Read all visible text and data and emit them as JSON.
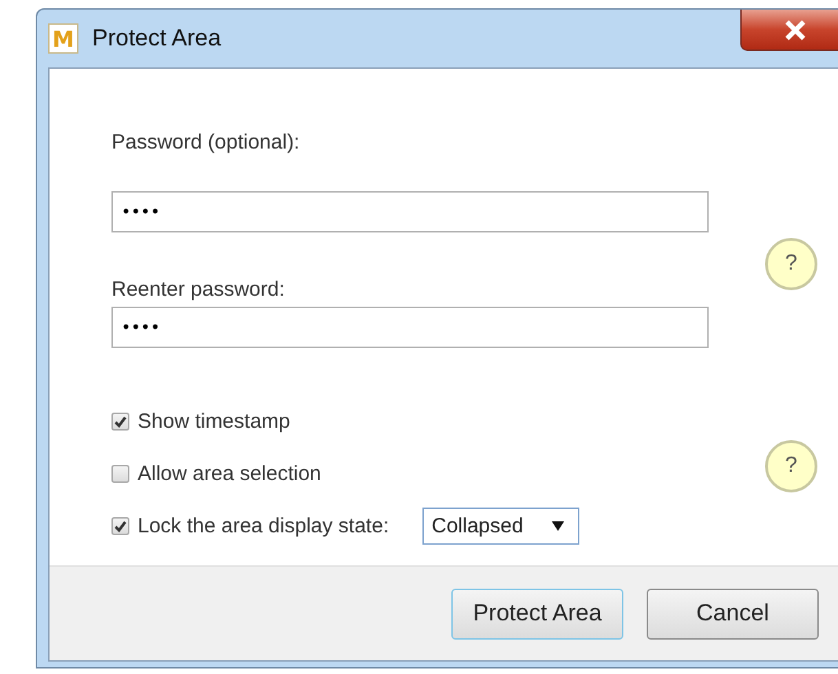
{
  "window": {
    "title": "Protect Area",
    "app_icon_letter": "M"
  },
  "password": {
    "label": "Password (optional):",
    "value": "••••"
  },
  "reenter": {
    "label": "Reenter password:",
    "value": "••••"
  },
  "help_buttons": [
    "?",
    "?"
  ],
  "options": [
    {
      "kind": "checkbox",
      "label": "Show timestamp",
      "checked": true
    },
    {
      "kind": "checkbox",
      "label": "Allow area selection",
      "checked": false
    },
    {
      "kind": "checkbox-select",
      "label": "Lock the area display state:",
      "checked": true,
      "select_value": "Collapsed"
    }
  ],
  "buttons": [
    {
      "label": "Protect Area",
      "default": true
    },
    {
      "label": "Cancel",
      "default": false
    }
  ]
}
